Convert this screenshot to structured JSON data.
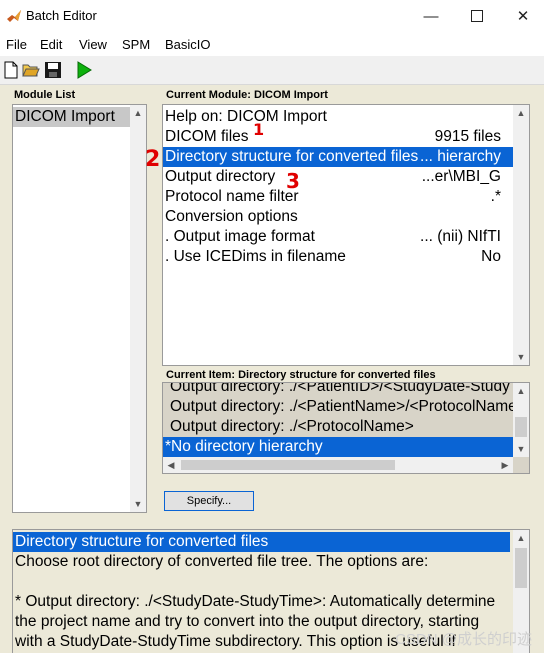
{
  "window": {
    "title": "Batch Editor"
  },
  "menu": [
    "File",
    "Edit",
    "View",
    "SPM",
    "BasicIO"
  ],
  "toolbar": {
    "icons": [
      "new-file-icon",
      "open-folder-icon",
      "save-icon",
      "run-icon"
    ]
  },
  "module_list": {
    "label": "Module List",
    "items": [
      "DICOM Import"
    ]
  },
  "current_module": {
    "label": "Current Module: DICOM Import",
    "rows": [
      {
        "name": "Help on: DICOM Import",
        "value": ""
      },
      {
        "name": "DICOM files",
        "value": "9915 files"
      },
      {
        "name": "Directory structure for converted files",
        "value": "... hierarchy"
      },
      {
        "name": "Output directory",
        "value": "...er\\MBI_G"
      },
      {
        "name": "Protocol name filter",
        "value": ".*"
      },
      {
        "name": "Conversion options",
        "value": ""
      },
      {
        "name": ". Output image format",
        "value": "... (nii) NIfTI"
      },
      {
        "name": ". Use ICEDims in filename",
        "value": "No"
      }
    ]
  },
  "current_item": {
    "label": "Current Item: Directory structure for converted files",
    "options": [
      "Output directory: ./<PatientID>/<StudyDate-StudyTime>",
      "Output directory: ./<PatientName>/<ProtocolName>",
      "Output directory: ./<ProtocolName>",
      "*No directory hierarchy"
    ],
    "specify_label": "Specify..."
  },
  "help": {
    "lines": [
      "Directory structure for converted files",
      "Choose root directory of converted file tree. The options are:",
      "",
      "* Output directory: ./<StudyDate-StudyTime>: Automatically determine",
      " the project name and try to convert into the output directory, starting",
      " with a StudyDate-StudyTime subdirectory. This option is useful if"
    ]
  },
  "annotations": [
    "1",
    "2",
    "3"
  ],
  "watermark": "CSDN @成长的印迹",
  "colors": {
    "selection": "#0A64D4",
    "window_bg": "#ECE9D8"
  }
}
